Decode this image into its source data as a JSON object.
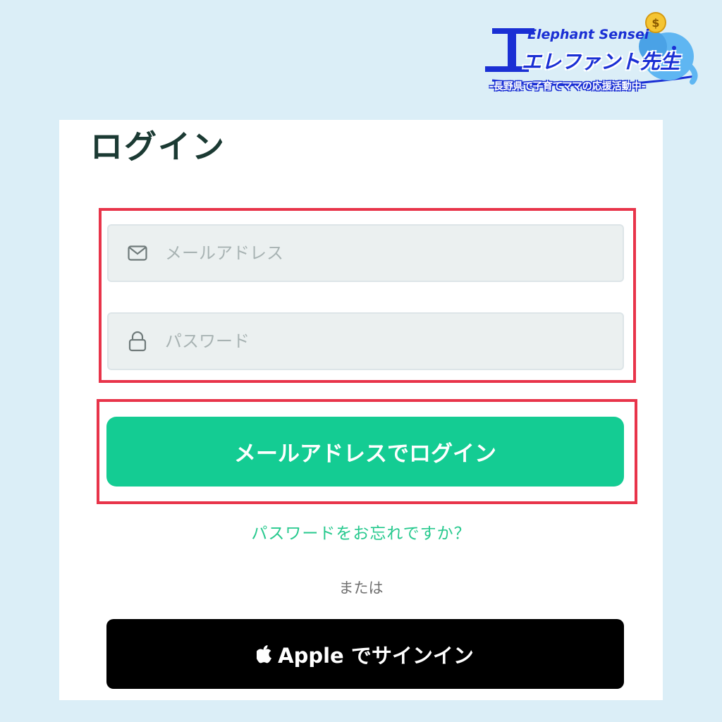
{
  "page": {
    "title": "ログイン"
  },
  "form": {
    "email_placeholder": "メールアドレス",
    "password_placeholder": "パスワード",
    "email_value": "",
    "password_value": "",
    "login_button": "メールアドレスでログイン",
    "forgot_link": "パスワードをお忘れですか？",
    "or_text": "または",
    "apple_button": "Apple でサインイン"
  },
  "logo": {
    "title_en": "Elephant Sensei",
    "title_jp": "エレファント先生",
    "tagline": "-長野県で子育てママの応援活動中-"
  },
  "icons": {
    "email": "mail-icon",
    "password": "lock-icon",
    "apple": "apple-icon",
    "coin": "dollar-coin-icon"
  },
  "colors": {
    "background": "#dbeef7",
    "accent": "#14cc93",
    "highlight": "#e8344a",
    "title": "#1b3a33",
    "logo": "#1a2fd4"
  }
}
